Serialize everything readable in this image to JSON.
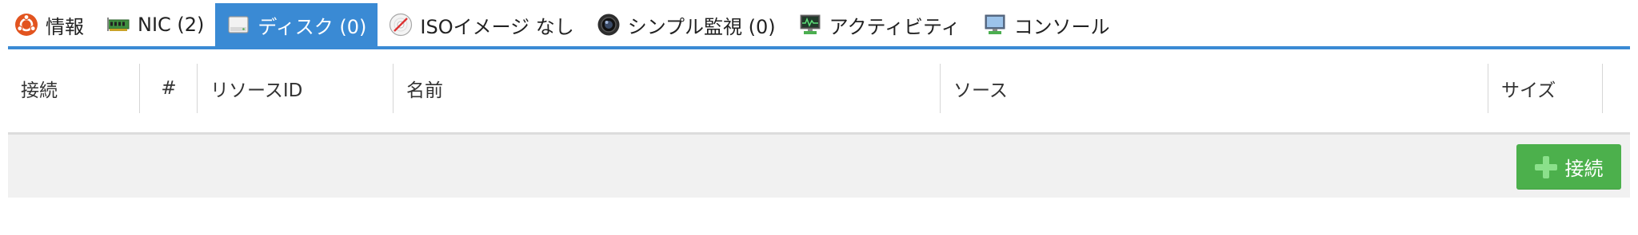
{
  "tabs": [
    {
      "id": "info",
      "label": "情報",
      "icon": "ubuntu-icon",
      "active": false
    },
    {
      "id": "nic",
      "label": "NIC (2)",
      "icon": "network-card-icon",
      "active": false
    },
    {
      "id": "disk",
      "label": "ディスク (0)",
      "icon": "disk-icon",
      "active": true
    },
    {
      "id": "iso",
      "label": "ISOイメージ なし",
      "icon": "cd-icon",
      "active": false
    },
    {
      "id": "monitor",
      "label": "シンプル監視 (0)",
      "icon": "camera-lens-icon",
      "active": false
    },
    {
      "id": "activity",
      "label": "アクティビティ",
      "icon": "activity-monitor-icon",
      "active": false
    },
    {
      "id": "console",
      "label": "コンソール",
      "icon": "console-monitor-icon",
      "active": false
    }
  ],
  "table": {
    "columns": [
      "接続",
      "#",
      "リソースID",
      "名前",
      "ソース",
      "サイズ"
    ]
  },
  "footer": {
    "connect_button": "接続"
  },
  "colors": {
    "accent": "#3a8ad4",
    "button": "#4cb04c",
    "footer_bg": "#f1f1f1"
  }
}
